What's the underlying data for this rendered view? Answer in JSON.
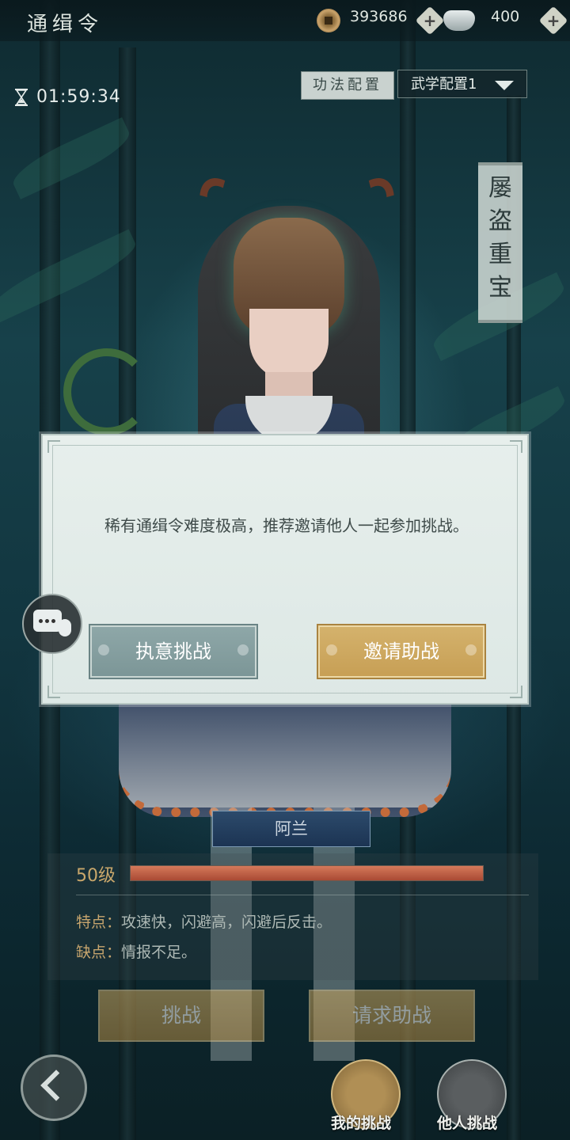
{
  "header": {
    "title": "通缉令",
    "coins": "393686",
    "ingots": "400",
    "icons": [
      "coin-icon",
      "silver-ingot-icon",
      "plus-icon"
    ]
  },
  "timer": "01:59:34",
  "config": {
    "gongfa_label": "功法配置",
    "wuxue_select": "武学配置1"
  },
  "banner": "屡盗重宝",
  "dialog": {
    "message": "稀有通缉令难度极高，推荐邀请他人一起参加挑战。",
    "insist_button": "执意挑战",
    "invite_button": "邀请助战"
  },
  "character": {
    "name": "阿兰",
    "level": "50级",
    "hp_fraction": 1.0,
    "trait_label": "特点：",
    "trait_text": "攻速快，闪避高，闪避后反击。",
    "weakness_label": "缺点：",
    "weakness_text": "情报不足。"
  },
  "actions": {
    "challenge": "挑战",
    "request_help": "请求助战"
  },
  "tabs": {
    "my_challenges": "我的挑战",
    "others_challenges": "他人挑战"
  },
  "colors": {
    "gold_button": "#c9a55e",
    "grey_button": "#8ea7a8",
    "hp_bar": "#c45f44",
    "dialog_bg": "#e4ece9"
  }
}
